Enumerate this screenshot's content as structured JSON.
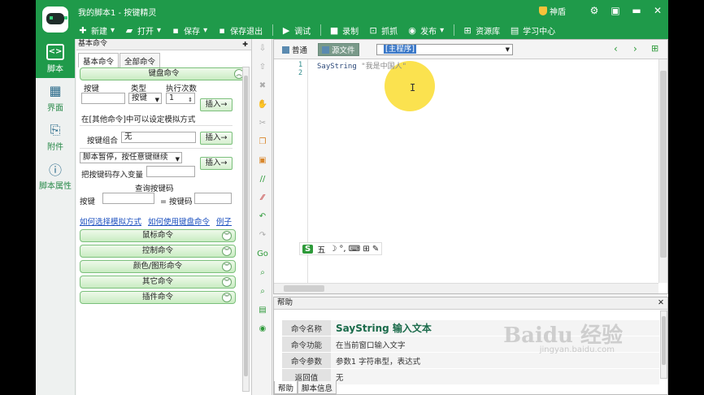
{
  "app": {
    "title": "我的脚本1 - 按键精灵",
    "brand_color": "#1f9a4a",
    "shield_label": "神盾"
  },
  "toolbar": [
    {
      "label": "新建",
      "icon": "plus-icon"
    },
    {
      "label": "打开",
      "icon": "folder-icon"
    },
    {
      "label": "保存",
      "icon": "save-icon"
    },
    {
      "label": "保存退出",
      "icon": "save-exit-icon"
    },
    {
      "label": "调试",
      "icon": "play-icon"
    },
    {
      "label": "录制",
      "icon": "record-icon"
    },
    {
      "label": "抓抓",
      "icon": "grab-icon"
    },
    {
      "label": "发布",
      "icon": "publish-icon"
    },
    {
      "label": "资源库",
      "icon": "resource-icon"
    },
    {
      "label": "学习中心",
      "icon": "book-icon"
    }
  ],
  "leftnav": [
    {
      "label": "脚本",
      "icon": "script-icon",
      "active": true
    },
    {
      "label": "界面",
      "icon": "grid-icon",
      "active": false
    },
    {
      "label": "附件",
      "icon": "attachment-icon",
      "active": false
    },
    {
      "label": "脚本属性",
      "icon": "info-icon",
      "active": false
    }
  ],
  "panel": {
    "header": "基本命令",
    "tabs": [
      "基本命令",
      "全部命令"
    ],
    "keyboard": {
      "section": "键盘命令",
      "col_key": "按键",
      "col_type": "类型",
      "col_times": "执行次数",
      "type_value": "按键",
      "times_value": "1",
      "insert": "插入→",
      "hint": "在[其他命令]中可以设定模拟方式",
      "combo_label": "按键组合",
      "combo_value": "无",
      "pause_value": "脚本暂停，按任意键继续",
      "save_code": "把按键码存入变量",
      "query_title": "查询按键码",
      "query_key": "按键",
      "query_code": "= 按键码"
    },
    "links": [
      "如何选择模拟方式",
      "如何使用键盘命令",
      "例子"
    ],
    "sections": [
      "鼠标命令",
      "控制命令",
      "颜色/图形命令",
      "其它命令",
      "插件命令"
    ]
  },
  "editor": {
    "tab_normal": "普通",
    "tab_source": "源文件",
    "dropdown_value": "[主程序]",
    "lines": [
      {
        "num": "1",
        "cmd": "SayString ",
        "arg": "\"我是中国人\""
      },
      {
        "num": "2",
        "cmd": "",
        "arg": ""
      }
    ]
  },
  "ime": {
    "logo": "S",
    "mode": "五",
    "icons": "☽ °, ⌨ ⊞ ✎"
  },
  "help": {
    "header": "帮助",
    "rows": [
      {
        "k": "命令名称",
        "v": "SayString 输入文本"
      },
      {
        "k": "命令功能",
        "v": "在当前窗口输入文字"
      },
      {
        "k": "命令参数",
        "v": "参数1 字符串型，表达式"
      },
      {
        "k": "返回值",
        "v": "无"
      }
    ],
    "tabs": [
      "帮助",
      "脚本信息"
    ]
  },
  "watermark": {
    "brand": "Baidu 经验",
    "url": "jingyan.baidu.com"
  }
}
